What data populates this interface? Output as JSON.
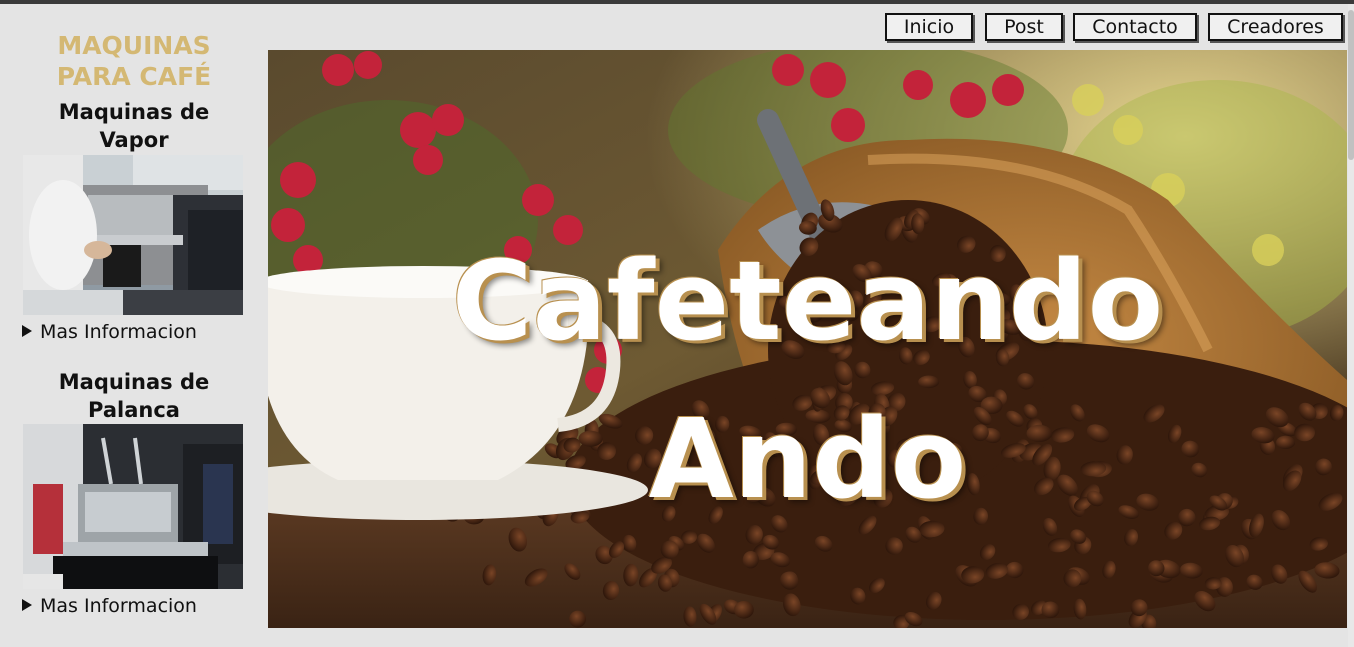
{
  "sidebar": {
    "brand_line1": "MAQUINAS",
    "brand_line2": "PARA CAFÉ",
    "machines": [
      {
        "title_line1": "Maquinas de",
        "title_line2": "Vapor",
        "more_label": "Mas Informacion"
      },
      {
        "title_line1": "Maquinas de",
        "title_line2": "Palanca",
        "more_label": "Mas Informacion"
      }
    ]
  },
  "nav": {
    "items": [
      {
        "label": "Inicio"
      },
      {
        "label": "Post"
      },
      {
        "label": "Contacto"
      },
      {
        "label": "Creadores"
      }
    ]
  },
  "hero": {
    "title_line1": "Cafeteando",
    "title_line2": "Ando"
  },
  "colors": {
    "brand": "#d4b873",
    "page_bg": "#e4e4e4",
    "title_shadow": "#b8904f"
  }
}
